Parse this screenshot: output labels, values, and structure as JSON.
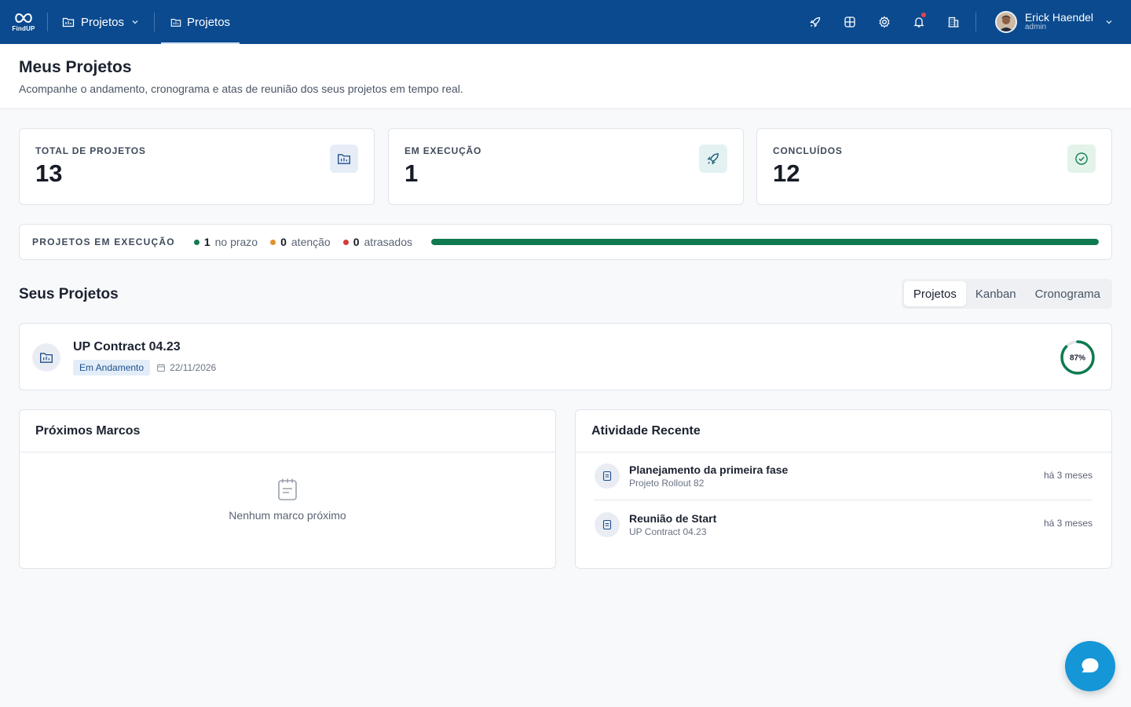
{
  "app": {
    "logo_text": "FindUP"
  },
  "nav": {
    "dropdown_label": "Projetos",
    "active_tab_label": "Projetos"
  },
  "user": {
    "name": "Erick Haendel",
    "role": "admin"
  },
  "header": {
    "title": "Meus Projetos",
    "subtitle": "Acompanhe o andamento, cronograma e atas de reunião dos seus projetos em tempo real."
  },
  "stats": [
    {
      "label": "TOTAL DE PROJETOS",
      "value": "13",
      "icon": "folder-icon",
      "icon_bg": "#e6edf6"
    },
    {
      "label": "EM EXECUÇÃO",
      "value": "1",
      "icon": "rocket-icon",
      "icon_bg": "#e4f1f2"
    },
    {
      "label": "CONCLUÍDOS",
      "value": "12",
      "icon": "check-circle-icon",
      "icon_bg": "#e4f3ea"
    }
  ],
  "execution": {
    "label": "PROJETOS EM EXECUÇÃO",
    "on_time": {
      "count": "1",
      "text": "no prazo",
      "color": "#0f7a4f"
    },
    "attention": {
      "count": "0",
      "text": "atenção",
      "color": "#e0912b"
    },
    "late": {
      "count": "0",
      "text": "atrasados",
      "color": "#d63a3a"
    },
    "on_time_fraction": 1.0
  },
  "projects_section": {
    "title": "Seus Projetos",
    "tabs": [
      {
        "label": "Projetos",
        "active": true
      },
      {
        "label": "Kanban",
        "active": false
      },
      {
        "label": "Cronograma",
        "active": false
      }
    ]
  },
  "project": {
    "name": "UP Contract 04.23",
    "status": "Em Andamento",
    "date": "22/11/2026",
    "progress_label": "87%",
    "progress": 0.87
  },
  "milestones": {
    "title": "Próximos Marcos",
    "empty_text": "Nenhum marco próximo"
  },
  "activity": {
    "title": "Atividade Recente",
    "items": [
      {
        "title": "Planejamento da primeira fase",
        "project": "Projeto Rollout 82",
        "time": "há 3 meses"
      },
      {
        "title": "Reunião de Start",
        "project": "UP Contract 04.23",
        "time": "há 3 meses"
      }
    ]
  },
  "colors": {
    "topbar": "#0b4a8f",
    "accent_green": "#0f7a4f",
    "fab": "#1596d6"
  }
}
